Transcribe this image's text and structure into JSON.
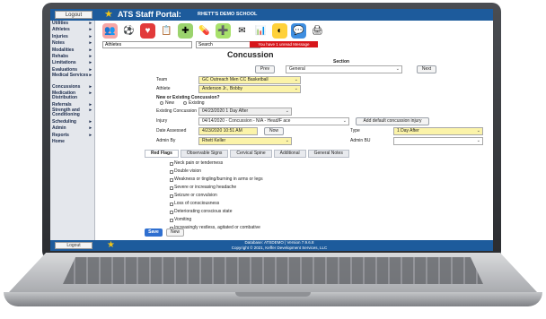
{
  "top_bar": {
    "logout_label": "Logout",
    "portal_title": "ATS Staff Portal:",
    "school_name": "RHETT'S DEMO SCHOOL"
  },
  "sidebar": {
    "items": [
      {
        "label": "Utilities"
      },
      {
        "label": "Athletes"
      },
      {
        "label": "Injuries"
      },
      {
        "label": "Notes"
      },
      {
        "label": "Modalities"
      },
      {
        "label": "Rehabs"
      },
      {
        "label": "Limitations"
      },
      {
        "label": "Evaluations"
      },
      {
        "label": "Medical Services"
      },
      {
        "label": "Concussions"
      },
      {
        "label": "Medication Distribution"
      },
      {
        "label": "Referrals"
      },
      {
        "label": "Strength and Conditioning"
      },
      {
        "label": "Scheduling"
      },
      {
        "label": "Admin"
      },
      {
        "label": "Reports"
      },
      {
        "label": "Home"
      }
    ]
  },
  "toolbar": {
    "icons": [
      "people-icon",
      "ball-icon",
      "heart-icon",
      "notes-icon",
      "rehab-icon",
      "pill-icon",
      "stethoscope-icon",
      "envelope-icon",
      "chart-icon",
      "calendar-icon",
      "chat-icon",
      "printer-icon"
    ],
    "athletes_select": "Athletes",
    "search_label": "Search",
    "alert_text": "You have 1 unread Message"
  },
  "form": {
    "title": "Concussion",
    "section_label": "Section",
    "prev_label": "Prev",
    "section_value": "General",
    "next_label": "Next",
    "team_label": "Team",
    "team_value": "GC Outreach Men CC Basketball",
    "athlete_label": "Athlete",
    "athlete_value": "Anderson Jr., Bobby",
    "new_or_existing_label": "New or Existing Concussion?",
    "radio_new": "New",
    "radio_existing": "Existing",
    "existing_label": "Existing Concussion",
    "existing_value": "04/23/2020 1 Day After",
    "injury_label": "Injury",
    "injury_value": "04/14/2020 - Concussion - N/A - Head/F ace",
    "add_default_label": "Add default concussion injury",
    "date_label": "Date Assessed",
    "date_value": "4/23/2020 10:51 AM",
    "now_label": "Now",
    "type_label": "Type",
    "type_value": "1 Day After",
    "admin_label": "Admin By",
    "admin_value": "Rhett Keller",
    "admin_bu_label": "Admin BU"
  },
  "tabs": [
    {
      "label": "Red Flags",
      "active": true
    },
    {
      "label": "Observable Signs",
      "active": false
    },
    {
      "label": "Cervical Spine",
      "active": false
    },
    {
      "label": "Additional",
      "active": false
    },
    {
      "label": "General Notes",
      "active": false
    }
  ],
  "symptoms": [
    "Neck pain or tenderness",
    "Double vision",
    "Weakness or tingling/burning in arms or legs",
    "Severe or increasing headache",
    "Seizure or convulsion",
    "Loss of consciousness",
    "Deteriorating conscious state",
    "Vomiting",
    "Increasingly restless, agitated or combative"
  ],
  "actions": {
    "save_label": "Save",
    "new_label": "New"
  },
  "bottom_bar": {
    "logout_label": "Logout",
    "database_line": "Database: ATSDEMO | Version 7.9.6.8",
    "copyright_line": "Copyright © 2021, Keffer Development Services, LLC"
  },
  "colors": {
    "header_blue": "#1d5b9c",
    "highlight_yellow": "#fbf3a9",
    "alert_red": "#d7161b",
    "save_blue": "#2f6fd0"
  }
}
